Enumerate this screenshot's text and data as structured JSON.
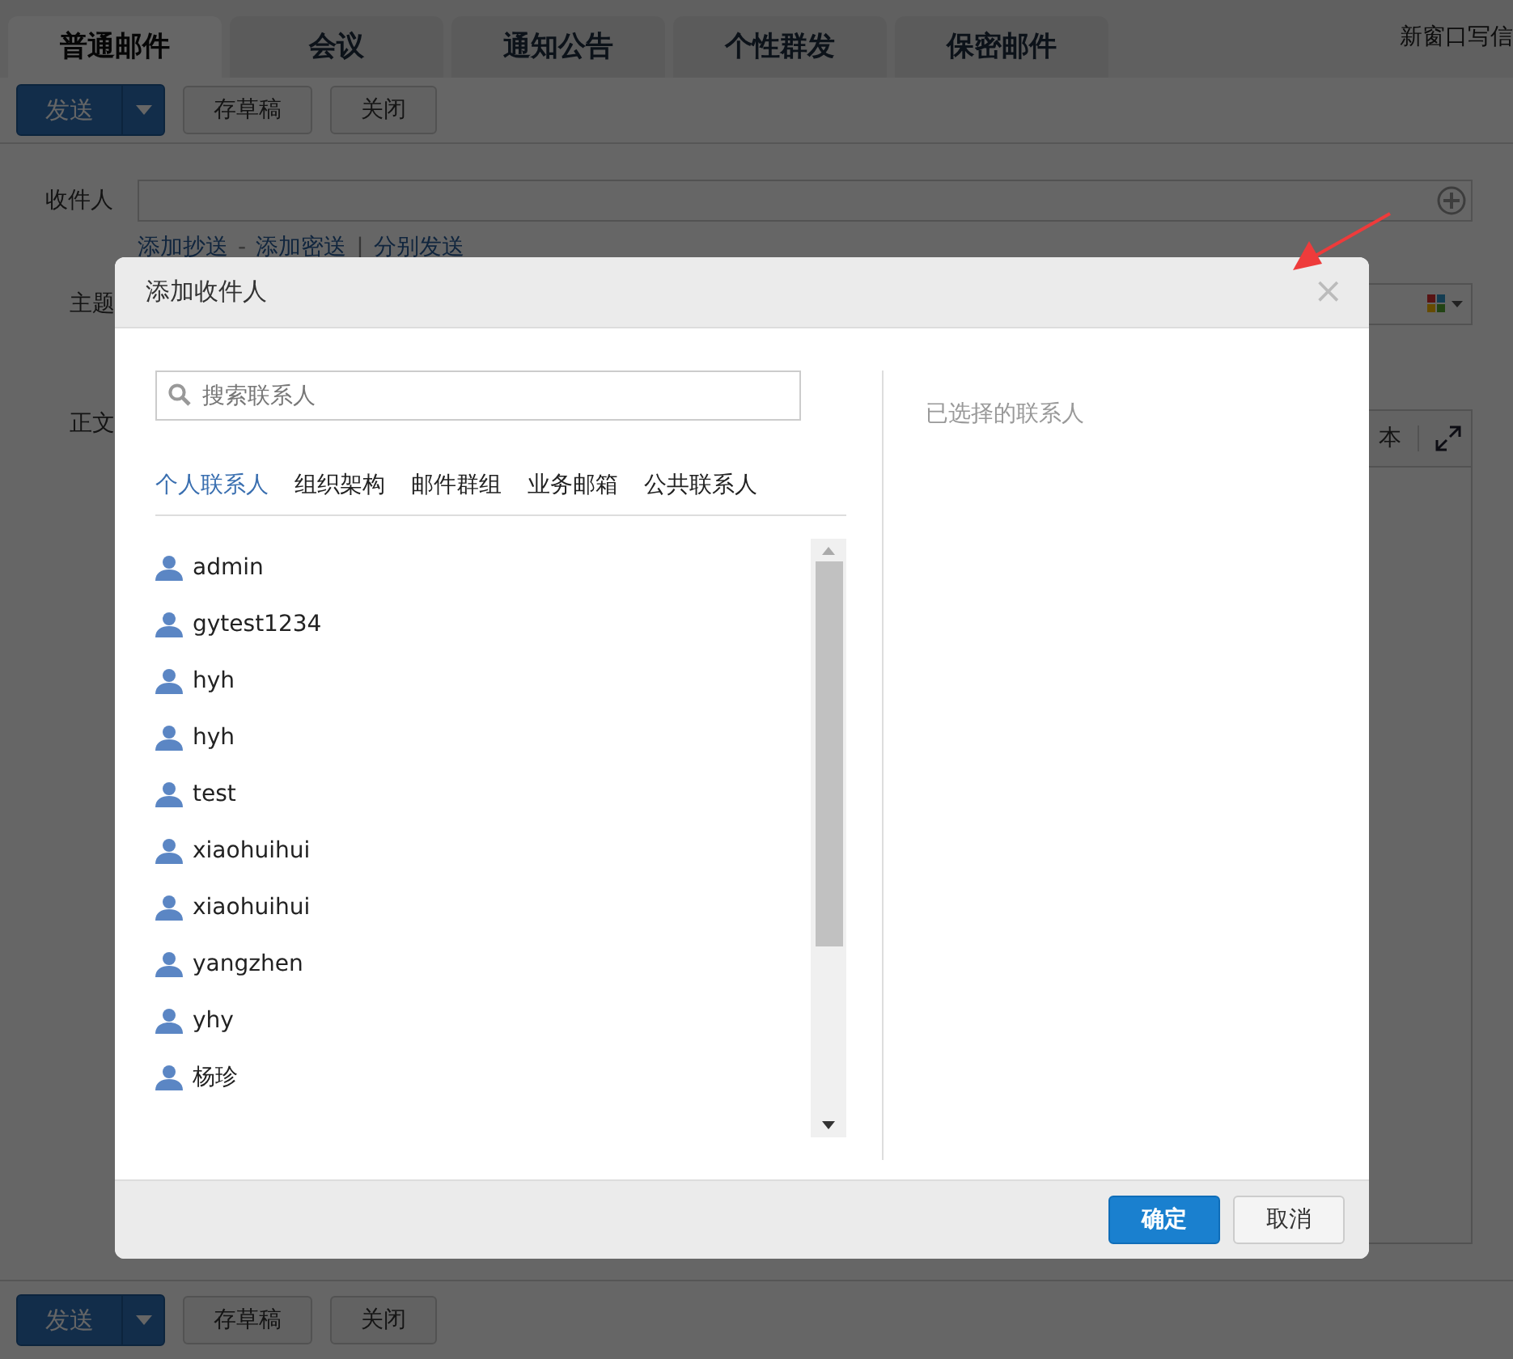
{
  "page": {
    "tabs": [
      {
        "label": "普通邮件",
        "selected": true
      },
      {
        "label": "会议",
        "selected": false
      },
      {
        "label": "通知公告",
        "selected": false
      },
      {
        "label": "个性群发",
        "selected": false
      },
      {
        "label": "保密邮件",
        "selected": false
      }
    ],
    "new_window_link": "新窗口写信",
    "toolbar": {
      "send": "发送",
      "draft": "存草稿",
      "close": "关闭"
    },
    "recipient_label": "收件人",
    "recipient_links": [
      {
        "kind": "link",
        "text": "添加抄送"
      },
      {
        "kind": "sep",
        "text": "-"
      },
      {
        "kind": "link",
        "text": "添加密送"
      },
      {
        "kind": "sep",
        "text": "|"
      },
      {
        "kind": "link",
        "text": "分别发送"
      }
    ],
    "subject_label": "主题",
    "body_label": "正文",
    "editor_toolbar_text": "本",
    "bottom_toolbar": {
      "send": "发送",
      "draft": "存草稿",
      "close": "关闭"
    }
  },
  "dialog": {
    "title": "添加收件人",
    "close": "×",
    "search": {
      "placeholder": "搜索联系人"
    },
    "tabs": [
      {
        "label": "个人联系人",
        "selected": true
      },
      {
        "label": "组织架构",
        "selected": false
      },
      {
        "label": "邮件群组",
        "selected": false
      },
      {
        "label": "业务邮箱",
        "selected": false
      },
      {
        "label": "公共联系人",
        "selected": false
      }
    ],
    "contacts": [
      "admin",
      "gytest1234",
      "hyh",
      "hyh",
      "test",
      "xiaohuihui",
      "xiaohuihui",
      "yangzhen",
      "yhy",
      "杨珍"
    ],
    "selected_heading": "已选择的联系人",
    "buttons": [
      {
        "label": "确定",
        "kind": "primary"
      },
      {
        "label": "取消",
        "kind": "default"
      }
    ]
  }
}
